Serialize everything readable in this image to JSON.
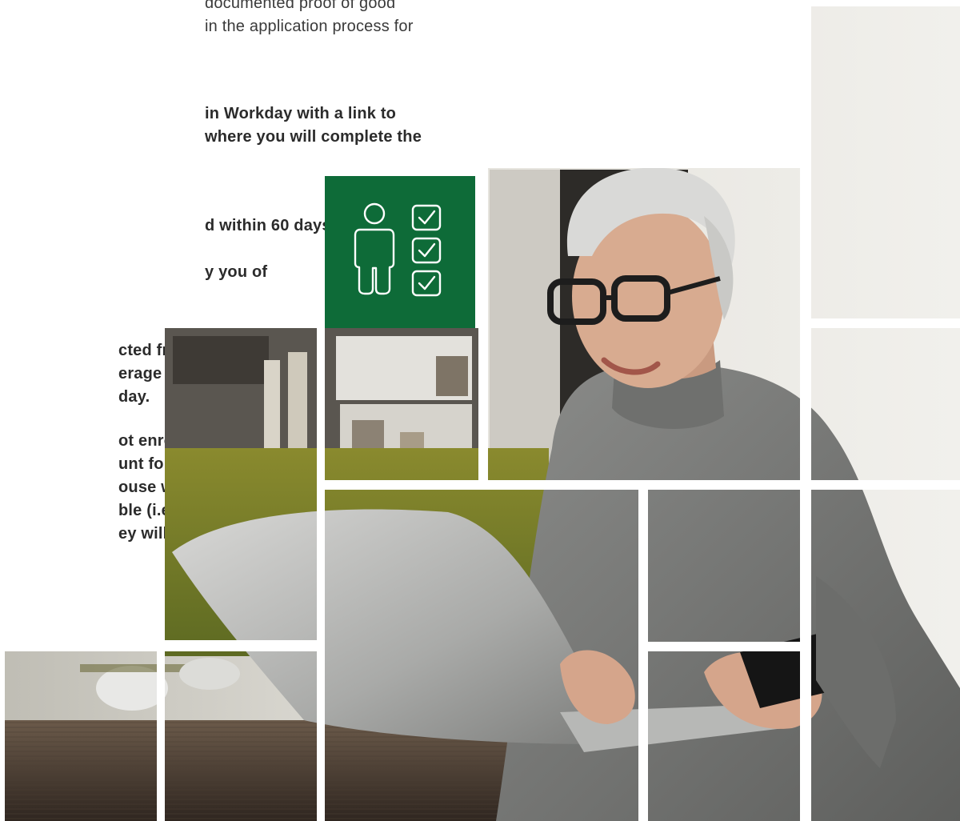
{
  "document": {
    "paragraphs": [
      {
        "id": "para-1",
        "weight": "normal",
        "lines": [
          "documented proof of good",
          "in the application process for"
        ]
      },
      {
        "id": "para-2",
        "weight": "bold",
        "lines": [
          "in Workday with a link to",
          "where you will complete the"
        ]
      },
      {
        "id": "para-3",
        "weight": "bold",
        "lines": [
          "d within 60 days."
        ]
      },
      {
        "id": "para-4",
        "weight": "bold",
        "lines": [
          "y you of"
        ]
      },
      {
        "id": "para-5",
        "weight": "bold",
        "lines": [
          "cted from",
          "erage will",
          "day."
        ]
      },
      {
        "id": "para-6",
        "weight": "bold",
        "lines": [
          "ot enroll in a",
          "unt for",
          "ouse when",
          "ble (i.e., new",
          "ey will be"
        ]
      }
    ]
  },
  "icon_tile": {
    "icon": "person-checklist-icon",
    "background_color": "#0e6b38",
    "icon_color": "#ffffff"
  },
  "photo": {
    "subject": "photo-woman-laptop"
  },
  "colors": {
    "accent_green": "#0e6b38",
    "text": "#2b2b2b"
  }
}
